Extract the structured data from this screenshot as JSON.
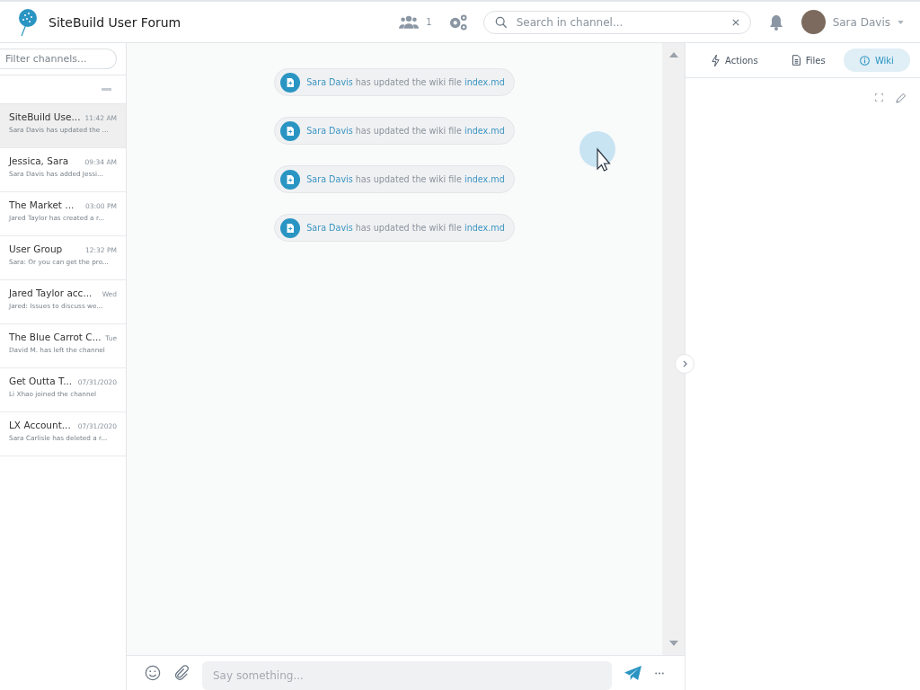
{
  "header": {
    "title": "SiteBuild User Forum",
    "member_count": "1",
    "search": {
      "placeholder": "Search in channel..."
    },
    "user": {
      "name": "Sara Davis"
    }
  },
  "sidebar": {
    "filter": {
      "placeholder": "Filter channels..."
    },
    "channels": [
      {
        "name": "SiteBuild Use...",
        "time": "11:42 AM",
        "preview": "Sara Davis has updated the ...",
        "selected": true
      },
      {
        "name": "Jessica, Sara",
        "time": "09:34 AM",
        "preview": "Sara Davis has added Jessi...",
        "selected": false
      },
      {
        "name": "The Market ...",
        "time": "03:00 PM",
        "preview": "Jared Taylor has created a r...",
        "selected": false
      },
      {
        "name": "User Group",
        "time": "12:32 PM",
        "preview": "Sara: Or you can get the pro...",
        "selected": false
      },
      {
        "name": "Jared Taylor acc...",
        "time": "Wed",
        "preview": "Jared: Issues to discuss we...",
        "selected": false
      },
      {
        "name": "The Blue Carrot C...",
        "time": "Tue",
        "preview": "David M. has left the channel",
        "selected": false
      },
      {
        "name": "Get Outta T...",
        "time": "07/31/2020",
        "preview": "Li Xhao joined the channel",
        "selected": false
      },
      {
        "name": "LX Account...",
        "time": "07/31/2020",
        "preview": "Sara Carlisle has deleted a r...",
        "selected": false
      }
    ]
  },
  "messages": [
    {
      "actor": "Sara Davis",
      "text": "has updated the wiki file",
      "file": "index.md"
    },
    {
      "actor": "Sara Davis",
      "text": "has updated the wiki file",
      "file": "index.md"
    },
    {
      "actor": "Sara Davis",
      "text": "has updated the wiki file",
      "file": "index.md"
    },
    {
      "actor": "Sara Davis",
      "text": "has updated the wiki file",
      "file": "index.md"
    }
  ],
  "composer": {
    "placeholder": "Say something..."
  },
  "right_panel": {
    "tabs": [
      {
        "label": "Actions",
        "kind": "actions",
        "selected": false
      },
      {
        "label": "Files",
        "kind": "files",
        "selected": false
      },
      {
        "label": "Wiki",
        "kind": "wiki",
        "selected": true
      }
    ]
  }
}
